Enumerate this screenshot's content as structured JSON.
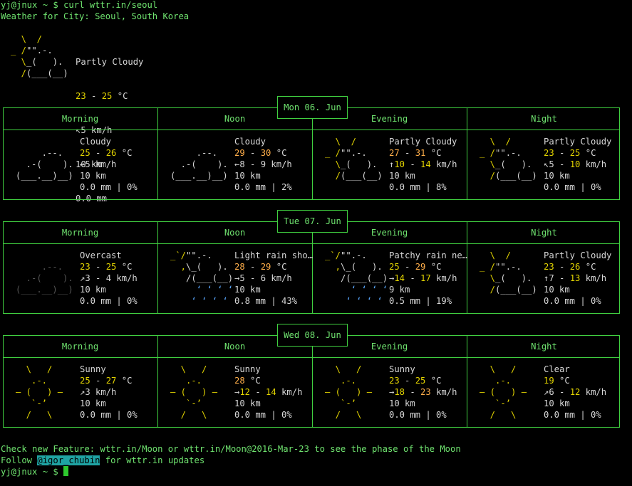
{
  "terminal": {
    "prompt": "yj@jnux ~ $ ",
    "command": "curl wttr.in/seoul",
    "location_line": "Weather for City: Seoul, South Korea"
  },
  "current": {
    "icon": [
      "  \\  /",
      "_ /\"\".-.",
      "  \\_(   ).",
      "  /(___(__)"
    ],
    "condition": "Partly Cloudy",
    "temp_a": "23",
    "temp_b": "25",
    "temp_unit": "°C",
    "wind_arrow": "↖",
    "wind": "5 km/h",
    "visibility": "10 km",
    "precip": "0.0 mm"
  },
  "days": [
    {
      "date": "Mon 06. Jun",
      "periods": [
        {
          "name": "Morning",
          "icon": [
            "",
            "     .--.",
            "  .-(    ).",
            "(___.__)__)"
          ],
          "icon_class": "w",
          "condition": "Cloudy",
          "t1": "25",
          "t2": "26",
          "unit": "°C",
          "t1c": "y",
          "t2c": "y",
          "arrow": "←",
          "w1": "5",
          "w2": "",
          "wunit": "km/h",
          "vis": "10 km",
          "precip": "0.0 mm | 0%"
        },
        {
          "name": "Noon",
          "icon": [
            "",
            "     .--.",
            "  .-(    ).",
            "(___.__)__)"
          ],
          "icon_class": "w",
          "condition": "Cloudy",
          "t1": "29",
          "t2": "30",
          "unit": "°C",
          "t1c": "o",
          "t2c": "o",
          "arrow": "←",
          "w1": "8",
          "w2": "9",
          "wunit": "km/h",
          "vis": "10 km",
          "precip": "0.0 mm | 2%"
        },
        {
          "name": "Evening",
          "icon": [
            "  \\  /",
            "_ /\"\".-.",
            "  \\_(   ).",
            "  /(___(__)"
          ],
          "icon_class": "mix",
          "condition": "Partly Cloudy",
          "t1": "27",
          "t2": "31",
          "unit": "°C",
          "t1c": "o",
          "t2c": "o",
          "arrow": "↑",
          "w1": "10",
          "w2": "14",
          "wunit": "km/h",
          "vis": "10 km",
          "precip": "0.0 mm | 8%"
        },
        {
          "name": "Night",
          "icon": [
            "  \\  /",
            "_ /\"\".-.",
            "  \\_(   ).",
            "  /(___(__)"
          ],
          "icon_class": "mix",
          "condition": "Partly Cloudy",
          "t1": "23",
          "t2": "25",
          "unit": "°C",
          "t1c": "y",
          "t2c": "y",
          "arrow": "↖",
          "w1": "5",
          "w2": "10",
          "wunit": "km/h",
          "vis": "10 km",
          "precip": "0.0 mm | 0%"
        }
      ]
    },
    {
      "date": "Tue 07. Jun",
      "periods": [
        {
          "name": "Morning",
          "icon": [
            "",
            "     .--.",
            "  .-(    ).",
            "(___.__)__)"
          ],
          "icon_class": "dim",
          "condition": "Overcast",
          "t1": "23",
          "t2": "25",
          "unit": "°C",
          "t1c": "y",
          "t2c": "y",
          "arrow": "↗",
          "w1": "3",
          "w2": "4",
          "wunit": "km/h",
          "vis": "10 km",
          "precip": "0.0 mm | 0%"
        },
        {
          "name": "Noon",
          "icon": [
            "_`/\"\".-.",
            "  ,\\_(   ).",
            "   /(___(__)",
            "     ‘ ‘ ‘ ‘",
            "    ‘ ‘ ‘ ‘"
          ],
          "icon_class": "rain",
          "condition": "Light rain sho…",
          "t1": "28",
          "t2": "29",
          "unit": "°C",
          "t1c": "o",
          "t2c": "o",
          "arrow": "→",
          "w1": "5",
          "w2": "6",
          "wunit": "km/h",
          "vis": "10 km",
          "precip": "0.8 mm | 43%"
        },
        {
          "name": "Evening",
          "icon": [
            "_`/\"\".-.",
            "  ,\\_(   ).",
            "   /(___(__)",
            "     ‘ ‘ ‘ ‘",
            "    ‘ ‘ ‘ ‘"
          ],
          "icon_class": "rain",
          "condition": "Patchy rain ne…",
          "t1": "25",
          "t2": "29",
          "unit": "°C",
          "t1c": "y",
          "t2c": "o",
          "arrow": "→",
          "w1": "14",
          "w2": "17",
          "wunit": "km/h",
          "vis": "9 km",
          "precip": "0.5 mm | 19%"
        },
        {
          "name": "Night",
          "icon": [
            "  \\  /",
            "_ /\"\".-.",
            "  \\_(   ).",
            "  /(___(__)"
          ],
          "icon_class": "mix",
          "condition": "Partly Cloudy",
          "t1": "23",
          "t2": "26",
          "unit": "°C",
          "t1c": "y",
          "t2c": "y",
          "arrow": "↑",
          "w1": "7",
          "w2": "13",
          "wunit": "km/h",
          "vis": "10 km",
          "precip": "0.0 mm | 0%"
        }
      ]
    },
    {
      "date": "Wed 08. Jun",
      "periods": [
        {
          "name": "Morning",
          "icon": [
            "  \\   /",
            "   .-.",
            "― (   ) ―",
            "   `-’",
            "  /   \\"
          ],
          "icon_class": "y",
          "condition": "Sunny",
          "t1": "25",
          "t2": "27",
          "unit": "°C",
          "t1c": "y",
          "t2c": "y",
          "arrow": "↗",
          "w1": "3",
          "w2": "",
          "wunit": "km/h",
          "vis": "10 km",
          "precip": "0.0 mm | 0%"
        },
        {
          "name": "Noon",
          "icon": [
            "  \\   /",
            "   .-.",
            "― (   ) ―",
            "   `-’",
            "  /   \\"
          ],
          "icon_class": "y",
          "condition": "Sunny",
          "t1": "28",
          "t2": "",
          "unit": "°C",
          "t1c": "o",
          "t2c": "o",
          "arrow": "→",
          "w1": "12",
          "w2": "14",
          "wunit": "km/h",
          "vis": "10 km",
          "precip": "0.0 mm | 0%"
        },
        {
          "name": "Evening",
          "icon": [
            "  \\   /",
            "   .-.",
            "― (   ) ―",
            "   `-’",
            "  /   \\"
          ],
          "icon_class": "y",
          "condition": "Sunny",
          "t1": "23",
          "t2": "25",
          "unit": "°C",
          "t1c": "y",
          "t2c": "y",
          "arrow": "→",
          "w1": "18",
          "w2": "23",
          "wunit": "km/h",
          "vis": "10 km",
          "precip": "0.0 mm | 0%"
        },
        {
          "name": "Night",
          "icon": [
            "  \\   /",
            "   .-.",
            "― (   ) ―",
            "   `-’",
            "  /   \\"
          ],
          "icon_class": "y",
          "condition": "Clear",
          "t1": "19",
          "t2": "",
          "unit": "°C",
          "t1c": "y",
          "t2c": "y",
          "arrow": "↗",
          "w1": "6",
          "w2": "12",
          "wunit": "km/h",
          "vis": "10 km",
          "precip": "0.0 mm | 0%"
        }
      ]
    }
  ],
  "footer": {
    "line1": "Check new Feature: wttr.in/Moon or wttr.in/Moon@2016-Mar-23 to see the phase of the Moon",
    "follow_prefix": "Follow ",
    "handle": "@igor_chubin",
    "follow_suffix": " for wttr.in updates",
    "prompt": "yj@jnux ~ $ "
  }
}
